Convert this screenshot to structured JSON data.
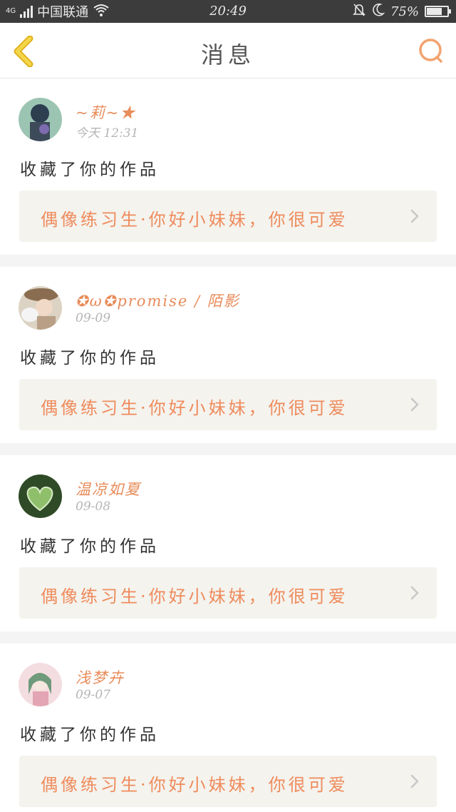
{
  "status_bar": {
    "network": "4G",
    "carrier": "中国联通",
    "time": "20:49",
    "battery": "75%",
    "battery_level": 0.75
  },
  "header": {
    "title": "消息"
  },
  "messages": [
    {
      "username": "~莉~★",
      "time": "今天 12:31",
      "action": "收藏了你的作品",
      "quote": "偶像练习生·你好小妹妹，你很可爱",
      "avatar_colors": [
        "#8fb8a8",
        "#2c3e50"
      ]
    },
    {
      "username": "✪ω✪promise / 陌影",
      "time": "09-09",
      "action": "收藏了你的作品",
      "quote": "偶像练习生·你好小妹妹，你很可爱",
      "avatar_colors": [
        "#d8cfc0",
        "#6b5a48"
      ]
    },
    {
      "username": "温凉如夏",
      "time": "09-08",
      "action": "收藏了你的作品",
      "quote": "偶像练习生·你好小妹妹，你很可爱",
      "avatar_colors": [
        "#4a6b3a",
        "#8fbf6a"
      ]
    },
    {
      "username": "浅梦卉",
      "time": "09-07",
      "action": "收藏了你的作品",
      "quote": "偶像练习生·你好小妹妹，你很可爱",
      "avatar_colors": [
        "#f2d4d9",
        "#6f9a7b"
      ]
    }
  ],
  "colors": {
    "accent": "#ef8b5c",
    "back_arrow": "#f2c93a",
    "search": "#f2a36f"
  }
}
